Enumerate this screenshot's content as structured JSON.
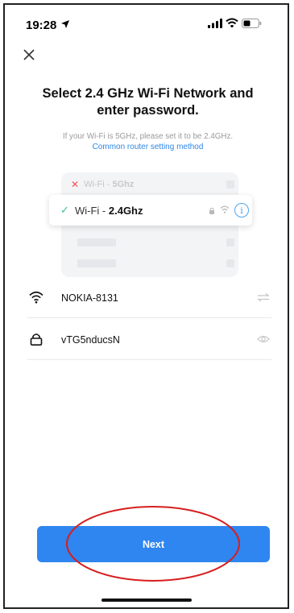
{
  "status_bar": {
    "time": "19:28"
  },
  "header": {
    "close_icon": "close-icon"
  },
  "title": "Select 2.4 GHz Wi-Fi Network and enter password.",
  "subtitle": "If your Wi-Fi is 5GHz, please set it to be 2.4GHz.",
  "link": "Common router setting method",
  "illustration": {
    "bad_prefix": "Wi-Fi - ",
    "bad_band": "5Ghz",
    "good_prefix": "Wi-Fi - ",
    "good_band": "2.4Ghz"
  },
  "network": {
    "ssid": "NOKIA-8131",
    "password": "vTG5nducsN"
  },
  "next_label": "Next",
  "colors": {
    "accent": "#2f86f0",
    "annotation": "#d81e1e",
    "check": "#3fbf8a",
    "cross": "#f05050"
  }
}
